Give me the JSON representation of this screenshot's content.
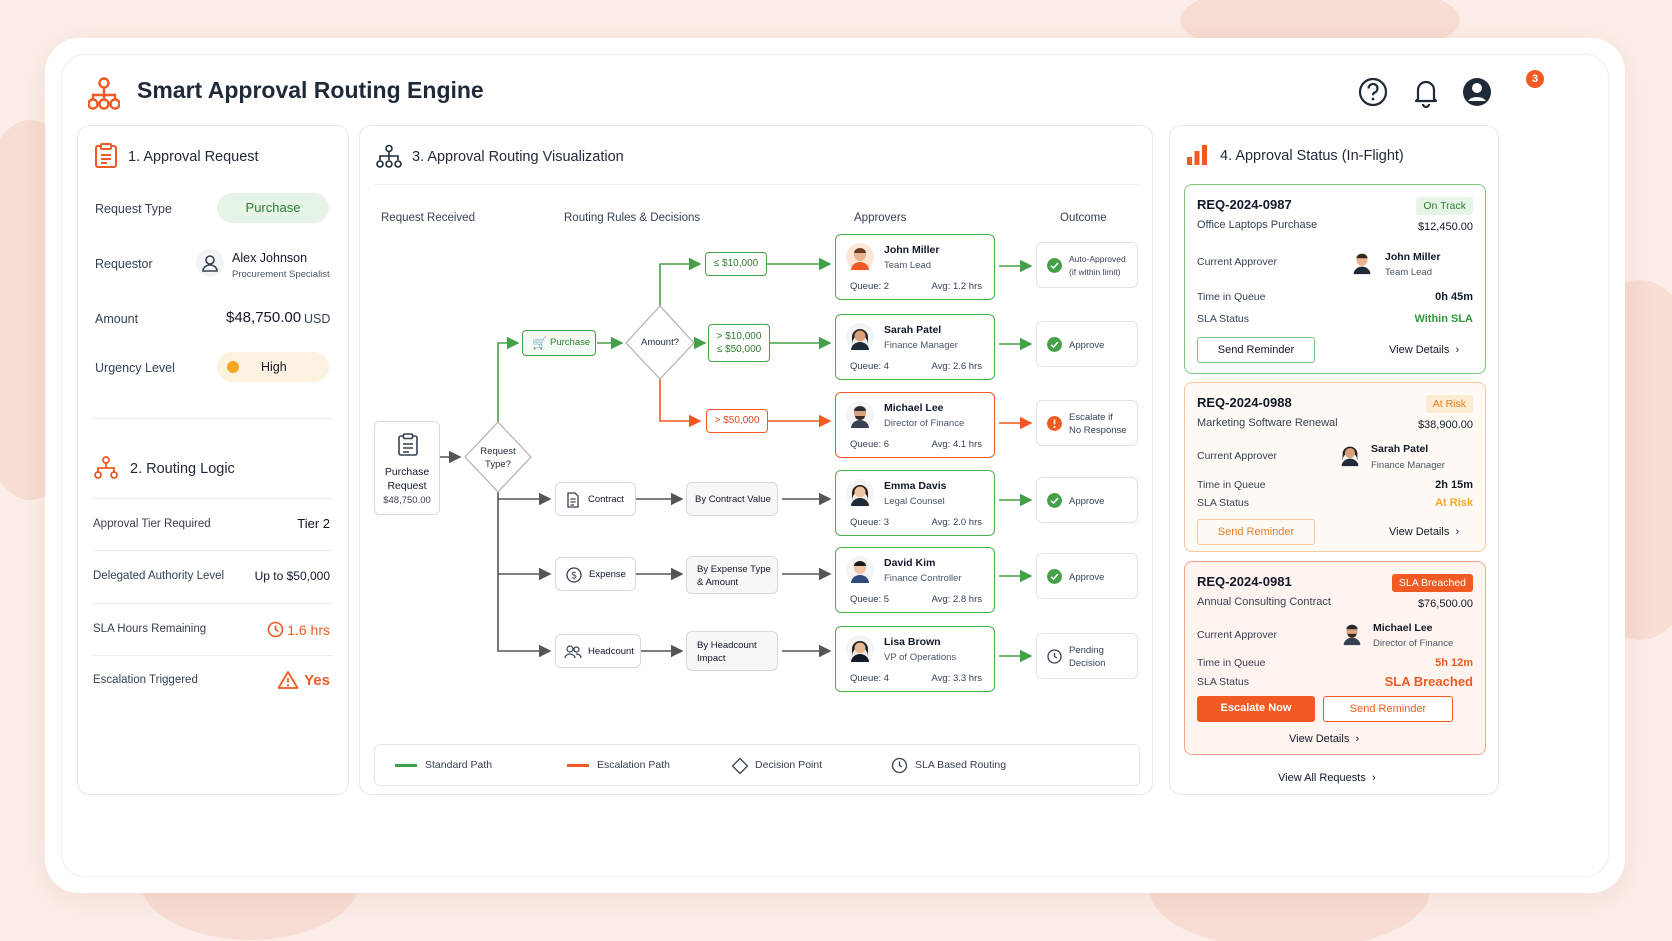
{
  "app": {
    "title": "Smart Approval Routing Engine",
    "notification_count": "3"
  },
  "request": {
    "title": "1. Approval Request",
    "type_label": "Request Type",
    "type_value": "Purchase",
    "requestor_label": "Requestor",
    "requestor_name": "Alex Johnson",
    "requestor_role": "Procurement Specialist",
    "amount_label": "Amount",
    "amount_value": "$48,750.00",
    "amount_currency": "USD",
    "urgency_label": "Urgency Level",
    "urgency_value": "High"
  },
  "routing_logic": {
    "title": "2. Routing Logic",
    "rows": [
      {
        "label": "Approval Tier Required",
        "value": "Tier 2"
      },
      {
        "label": "Delegated Authority Level",
        "value": "Up to $50,000"
      },
      {
        "label": "SLA Hours Remaining",
        "value": "1.6 hrs"
      },
      {
        "label": "Escalation Triggered",
        "value": "Yes"
      }
    ]
  },
  "viz": {
    "title": "3. Approval Routing Visualization",
    "columns": [
      "Request Received",
      "Routing Rules & Decisions",
      "Approvers",
      "Outcome"
    ],
    "source": {
      "line1": "Purchase",
      "line2": "Request",
      "amount": "$48,750.00"
    },
    "decision1": {
      "line1": "Request",
      "line2": "Type?"
    },
    "decision2": "Amount?",
    "purchase": "Purchase",
    "tiers": {
      "t1": "≤ $10,000",
      "t2a": "> $10,000",
      "t2b": "≤ $50,000",
      "t3": "> $50,000"
    },
    "types": [
      {
        "label": "Contract",
        "rule1": "By Contract Value",
        "rule2": ""
      },
      {
        "label": "Expense",
        "rule1": "By Expense Type",
        "rule2": "& Amount"
      },
      {
        "label": "Headcount",
        "rule1": "By Headcount",
        "rule2": "Impact"
      }
    ],
    "approvers": [
      {
        "name": "John Miller",
        "role": "Team Lead",
        "queue": "Queue: 2",
        "avg": "Avg: 1.2 hrs"
      },
      {
        "name": "Sarah Patel",
        "role": "Finance Manager",
        "queue": "Queue: 4",
        "avg": "Avg: 2.6 hrs"
      },
      {
        "name": "Michael Lee",
        "role": "Director of Finance",
        "queue": "Queue: 6",
        "avg": "Avg: 4.1 hrs"
      },
      {
        "name": "Emma Davis",
        "role": "Legal Counsel",
        "queue": "Queue: 3",
        "avg": "Avg: 2.0 hrs"
      },
      {
        "name": "David Kim",
        "role": "Finance Controller",
        "queue": "Queue: 5",
        "avg": "Avg: 2.8 hrs"
      },
      {
        "name": "Lisa Brown",
        "role": "VP of Operations",
        "queue": "Queue: 4",
        "avg": "Avg: 3.3 hrs"
      }
    ],
    "outcomes": [
      {
        "line1": "Auto-Approved",
        "line2": "(if within limit)"
      },
      {
        "line1": "Approve",
        "line2": ""
      },
      {
        "line1": "Escalate if",
        "line2": "No Response"
      },
      {
        "line1": "Approve",
        "line2": ""
      },
      {
        "line1": "Approve",
        "line2": ""
      },
      {
        "line1": "Pending",
        "line2": "Decision"
      }
    ],
    "legend": [
      "Standard Path",
      "Escalation Path",
      "Decision Point",
      "SLA Based Routing"
    ]
  },
  "status": {
    "title": "4. Approval Status (In-Flight)",
    "approver_label": "Current Approver",
    "queue_label": "Time in Queue",
    "sla_label": "SLA Status",
    "view_details": "View Details",
    "view_all": "View All Requests",
    "cards": [
      {
        "id": "REQ-2024-0987",
        "desc": "Office Laptops Purchase",
        "state": "On Track",
        "amount": "$12,450.00",
        "approver": "John Miller",
        "role": "Team Lead",
        "queue": "0h 45m",
        "sla": "Within SLA",
        "btn": "Send Reminder"
      },
      {
        "id": "REQ-2024-0988",
        "desc": "Marketing Software Renewal",
        "state": "At Risk",
        "amount": "$38,900.00",
        "approver": "Sarah Patel",
        "role": "Finance Manager",
        "queue": "2h 15m",
        "sla": "At Risk",
        "btn": "Send Reminder"
      },
      {
        "id": "REQ-2024-0981",
        "desc": "Annual Consulting Contract",
        "state": "SLA Breached",
        "amount": "$76,500.00",
        "approver": "Michael Lee",
        "role": "Director of Finance",
        "queue": "5h 12m",
        "sla": "SLA Breached",
        "btn": "Escalate Now",
        "btn2": "Send Reminder"
      }
    ]
  },
  "colors": {
    "accent": "#f15a22",
    "green": "#4caf50",
    "amber": "#f5a623"
  }
}
